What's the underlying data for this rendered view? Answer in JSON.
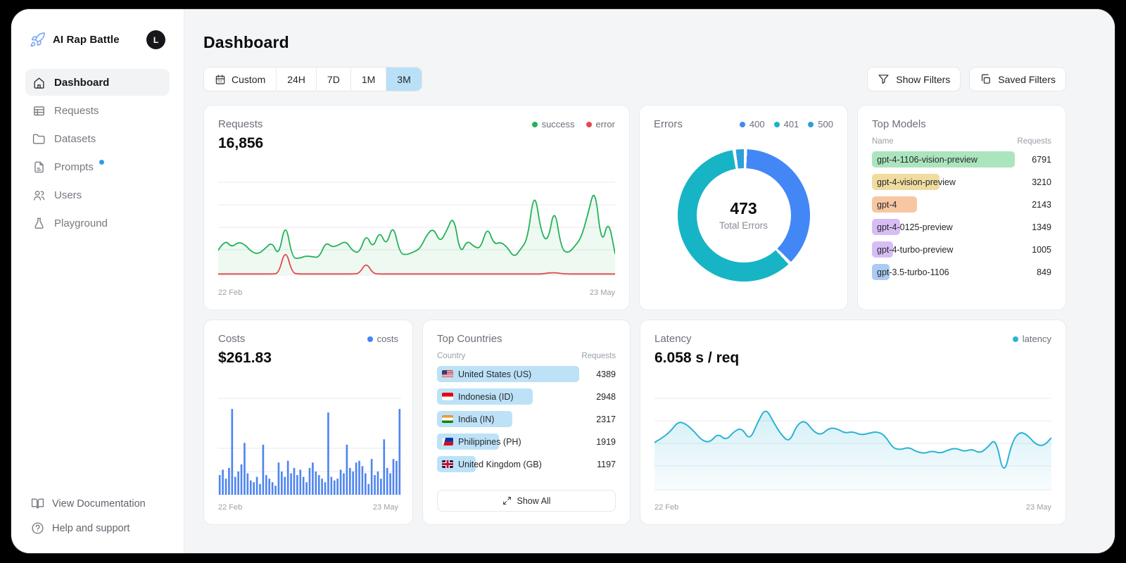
{
  "app": {
    "name": "AI Rap Battle",
    "avatar_initial": "L"
  },
  "sidebar": {
    "items": [
      {
        "label": "Dashboard",
        "icon": "home-icon",
        "active": true
      },
      {
        "label": "Requests",
        "icon": "table-icon",
        "active": false
      },
      {
        "label": "Datasets",
        "icon": "folder-icon",
        "active": false
      },
      {
        "label": "Prompts",
        "icon": "file-icon",
        "active": false,
        "badge_dot": true
      },
      {
        "label": "Users",
        "icon": "users-icon",
        "active": false
      },
      {
        "label": "Playground",
        "icon": "flask-icon",
        "active": false
      }
    ],
    "footer": [
      {
        "label": "View Documentation",
        "icon": "book-icon"
      },
      {
        "label": "Help and support",
        "icon": "help-icon"
      }
    ]
  },
  "header": {
    "title": "Dashboard",
    "time_ranges": [
      {
        "label": "Custom",
        "icon": "calendar-icon",
        "active": false
      },
      {
        "label": "24H",
        "active": false
      },
      {
        "label": "7D",
        "active": false
      },
      {
        "label": "1M",
        "active": false
      },
      {
        "label": "3M",
        "active": true
      }
    ],
    "filter_buttons": [
      {
        "label": "Show Filters",
        "icon": "funnel-icon"
      },
      {
        "label": "Saved Filters",
        "icon": "copy-icon"
      }
    ]
  },
  "cards": {
    "requests": {
      "title": "Requests",
      "value": "16,856",
      "legend": [
        {
          "label": "success",
          "color": "#23b259"
        },
        {
          "label": "error",
          "color": "#e5484d"
        }
      ],
      "x_start": "22 Feb",
      "x_end": "23 May"
    },
    "errors": {
      "title": "Errors",
      "center_value": "473",
      "center_label": "Total Errors",
      "legend": [
        {
          "label": "400",
          "color": "#4287f5"
        },
        {
          "label": "401",
          "color": "#17b4c6"
        },
        {
          "label": "500",
          "color": "#2e9fd9"
        }
      ]
    },
    "top_models": {
      "title": "Top Models",
      "col_name": "Name",
      "col_value": "Requests",
      "rows": [
        {
          "name": "gpt-4-1106-vision-preview",
          "requests": "6791",
          "color": "#abe5bd"
        },
        {
          "name": "gpt-4-vision-preview",
          "requests": "3210",
          "color": "#efdc9e"
        },
        {
          "name": "gpt-4",
          "requests": "2143",
          "color": "#f8c7a2"
        },
        {
          "name": "gpt-4-0125-preview",
          "requests": "1349",
          "color": "#d8bdf4"
        },
        {
          "name": "gpt-4-turbo-preview",
          "requests": "1005",
          "color": "#d8bdf4"
        },
        {
          "name": "gpt-3.5-turbo-1106",
          "requests": "849",
          "color": "#abcbf3"
        }
      ]
    },
    "costs": {
      "title": "Costs",
      "value": "$261.83",
      "legend": [
        {
          "label": "costs",
          "color": "#4285f5"
        }
      ],
      "x_start": "22 Feb",
      "x_end": "23 May"
    },
    "top_countries": {
      "title": "Top Countries",
      "col_name": "Country",
      "col_value": "Requests",
      "bar_color": "#bde2f7",
      "show_all_label": "Show All",
      "rows": [
        {
          "name": "United States (US)",
          "flag": "us",
          "requests": "4389"
        },
        {
          "name": "Indonesia (ID)",
          "flag": "id",
          "requests": "2948"
        },
        {
          "name": "India (IN)",
          "flag": "in",
          "requests": "2317"
        },
        {
          "name": "Philippines (PH)",
          "flag": "ph",
          "requests": "1919"
        },
        {
          "name": "United Kingdom (GB)",
          "flag": "gb",
          "requests": "1197"
        }
      ]
    },
    "latency": {
      "title": "Latency",
      "value": "6.058 s / req",
      "legend": [
        {
          "label": "latency",
          "color": "#2bb3d4"
        }
      ],
      "x_start": "22 Feb",
      "x_end": "23 May"
    }
  },
  "chart_data": [
    {
      "id": "requests",
      "type": "line",
      "title": "Requests over time",
      "x_range": [
        "22 Feb",
        "23 May"
      ],
      "grid": true,
      "legend_position": "top-right",
      "ymax": 195,
      "series": [
        {
          "name": "success",
          "color": "#23b259",
          "values": [
            52,
            75,
            58,
            70,
            64,
            48,
            44,
            56,
            70,
            38,
            115,
            36,
            34,
            40,
            38,
            36,
            70,
            58,
            64,
            72,
            50,
            46,
            88,
            55,
            95,
            60,
            110,
            45,
            42,
            48,
            55,
            85,
            100,
            68,
            95,
            128,
            42,
            74,
            60,
            55,
            104,
            64,
            70,
            58,
            36,
            55,
            76,
            185,
            90,
            68,
            148,
            55,
            45,
            60,
            80,
            132,
            190,
            60,
            120,
            45
          ]
        },
        {
          "name": "error",
          "color": "#e5484d",
          "values": [
            1,
            1,
            1,
            1,
            1,
            1,
            1,
            1,
            1,
            2,
            56,
            3,
            1,
            1,
            1,
            1,
            1,
            1,
            1,
            1,
            1,
            2,
            26,
            2,
            1,
            1,
            1,
            1,
            1,
            1,
            1,
            1,
            1,
            1,
            1,
            1,
            1,
            1,
            1,
            1,
            1,
            1,
            1,
            1,
            1,
            1,
            1,
            1,
            1,
            3,
            4,
            2,
            1,
            1,
            1,
            1,
            1,
            1,
            1,
            1
          ]
        }
      ]
    },
    {
      "id": "errors",
      "type": "pie",
      "title": "Errors by status code",
      "total_label": "Total Errors",
      "total": 473,
      "labels": [
        "400",
        "401",
        "500"
      ],
      "values": [
        177,
        283,
        13
      ],
      "colors": [
        "#4287f5",
        "#17b4c6",
        "#2e9fd9"
      ]
    },
    {
      "id": "costs",
      "type": "bar",
      "title": "Costs over time",
      "x_range": [
        "22 Feb",
        "23 May"
      ],
      "grid": true,
      "color": "#4f85f1",
      "ymax": 100,
      "values": [
        22,
        28,
        18,
        30,
        96,
        20,
        26,
        34,
        58,
        24,
        16,
        14,
        20,
        12,
        56,
        22,
        18,
        14,
        10,
        36,
        26,
        20,
        38,
        24,
        30,
        22,
        28,
        20,
        14,
        30,
        36,
        26,
        22,
        18,
        14,
        92,
        20,
        16,
        18,
        28,
        24,
        56,
        30,
        26,
        36,
        38,
        32,
        24,
        12,
        40,
        22,
        26,
        18,
        62,
        30,
        24,
        40,
        38,
        96
      ]
    },
    {
      "id": "latency",
      "type": "area",
      "title": "Latency over time",
      "x_range": [
        "22 Feb",
        "23 May"
      ],
      "grid": true,
      "color": "#2bb3d4",
      "ymax": 95,
      "values": [
        50,
        55,
        62,
        73,
        70,
        62,
        52,
        50,
        60,
        52,
        62,
        66,
        52,
        72,
        88,
        72,
        58,
        50,
        70,
        74,
        62,
        58,
        66,
        65,
        60,
        62,
        58,
        60,
        62,
        58,
        44,
        42,
        45,
        40,
        38,
        41,
        38,
        42,
        44,
        40,
        43,
        38,
        45,
        55,
        12,
        50,
        62,
        58,
        48,
        46,
        55
      ]
    }
  ]
}
